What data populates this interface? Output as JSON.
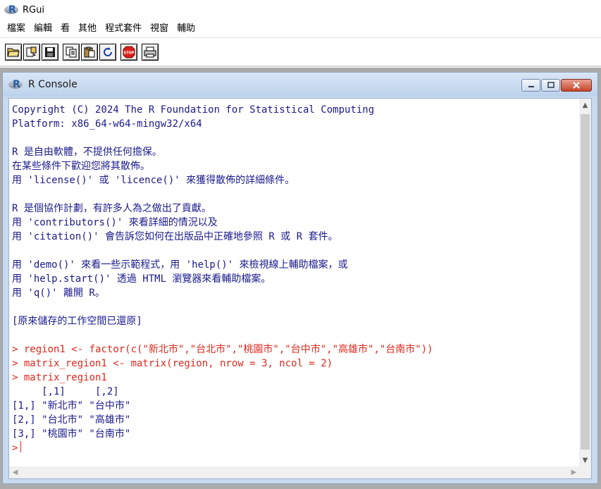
{
  "app": {
    "title": "RGui"
  },
  "menu": [
    "檔案",
    "編輯",
    "看",
    "其他",
    "程式套件",
    "視窗",
    "輔助"
  ],
  "toolbar": {
    "buttons": [
      "open-script",
      "load-workspace",
      "save-workspace",
      "copy",
      "paste",
      "copy-and-paste",
      "stop-current-computation",
      "print"
    ],
    "stop_label": "STOP"
  },
  "console": {
    "title": "R Console",
    "window_buttons": [
      "minimize",
      "maximize",
      "close"
    ],
    "lines": [
      {
        "text": "Copyright (C) 2024 The R Foundation for Statistical Computing",
        "type": "output"
      },
      {
        "text": "Platform: x86_64-w64-mingw32/x64",
        "type": "output"
      },
      {
        "text": "",
        "type": "output"
      },
      {
        "text": "R 是自由軟體，不提供任何擔保。",
        "type": "output"
      },
      {
        "text": "在某些條件下歡迎您將其散佈。",
        "type": "output"
      },
      {
        "text": "用 'license()' 或 'licence()' 來獲得散佈的詳細條件。",
        "type": "output"
      },
      {
        "text": "",
        "type": "output"
      },
      {
        "text": "R 是個協作計劃，有許多人為之做出了貢獻。",
        "type": "output"
      },
      {
        "text": "用 'contributors()' 來看詳細的情況以及",
        "type": "output"
      },
      {
        "text": "用 'citation()' 會告訴您如何在出版品中正確地參照 R 或 R 套件。",
        "type": "output"
      },
      {
        "text": "",
        "type": "output"
      },
      {
        "text": "用 'demo()' 來看一些示範程式，用 'help()' 來檢視線上輔助檔案，或",
        "type": "output"
      },
      {
        "text": "用 'help.start()' 透過 HTML 瀏覽器來看輔助檔案。",
        "type": "output"
      },
      {
        "text": "用 'q()' 離開 R。",
        "type": "output"
      },
      {
        "text": "",
        "type": "output"
      },
      {
        "text": "[原來儲存的工作空間已還原]",
        "type": "output"
      },
      {
        "text": "",
        "type": "output"
      },
      {
        "text": "> region1 <- factor(c(\"新北市\",\"台北市\",\"桃園市\",\"台中市\",\"高雄市\",\"台南市\"))",
        "type": "command"
      },
      {
        "text": "> matrix_region1 <- matrix(region, nrow = 3, ncol = 2)",
        "type": "command"
      },
      {
        "text": "> matrix_region1",
        "type": "command"
      },
      {
        "text": "     [,1]     [,2]",
        "type": "output"
      },
      {
        "text": "[1,] \"新北市\" \"台中市\"",
        "type": "output"
      },
      {
        "text": "[2,] \"台北市\" \"高雄市\"",
        "type": "output"
      },
      {
        "text": "[3,] \"桃園市\" \"台南市\"",
        "type": "output"
      }
    ],
    "prompt": ">"
  },
  "colors": {
    "output_text": "#1a1a8c",
    "command_text": "#e0271d",
    "mdi_background": "#ababab"
  }
}
